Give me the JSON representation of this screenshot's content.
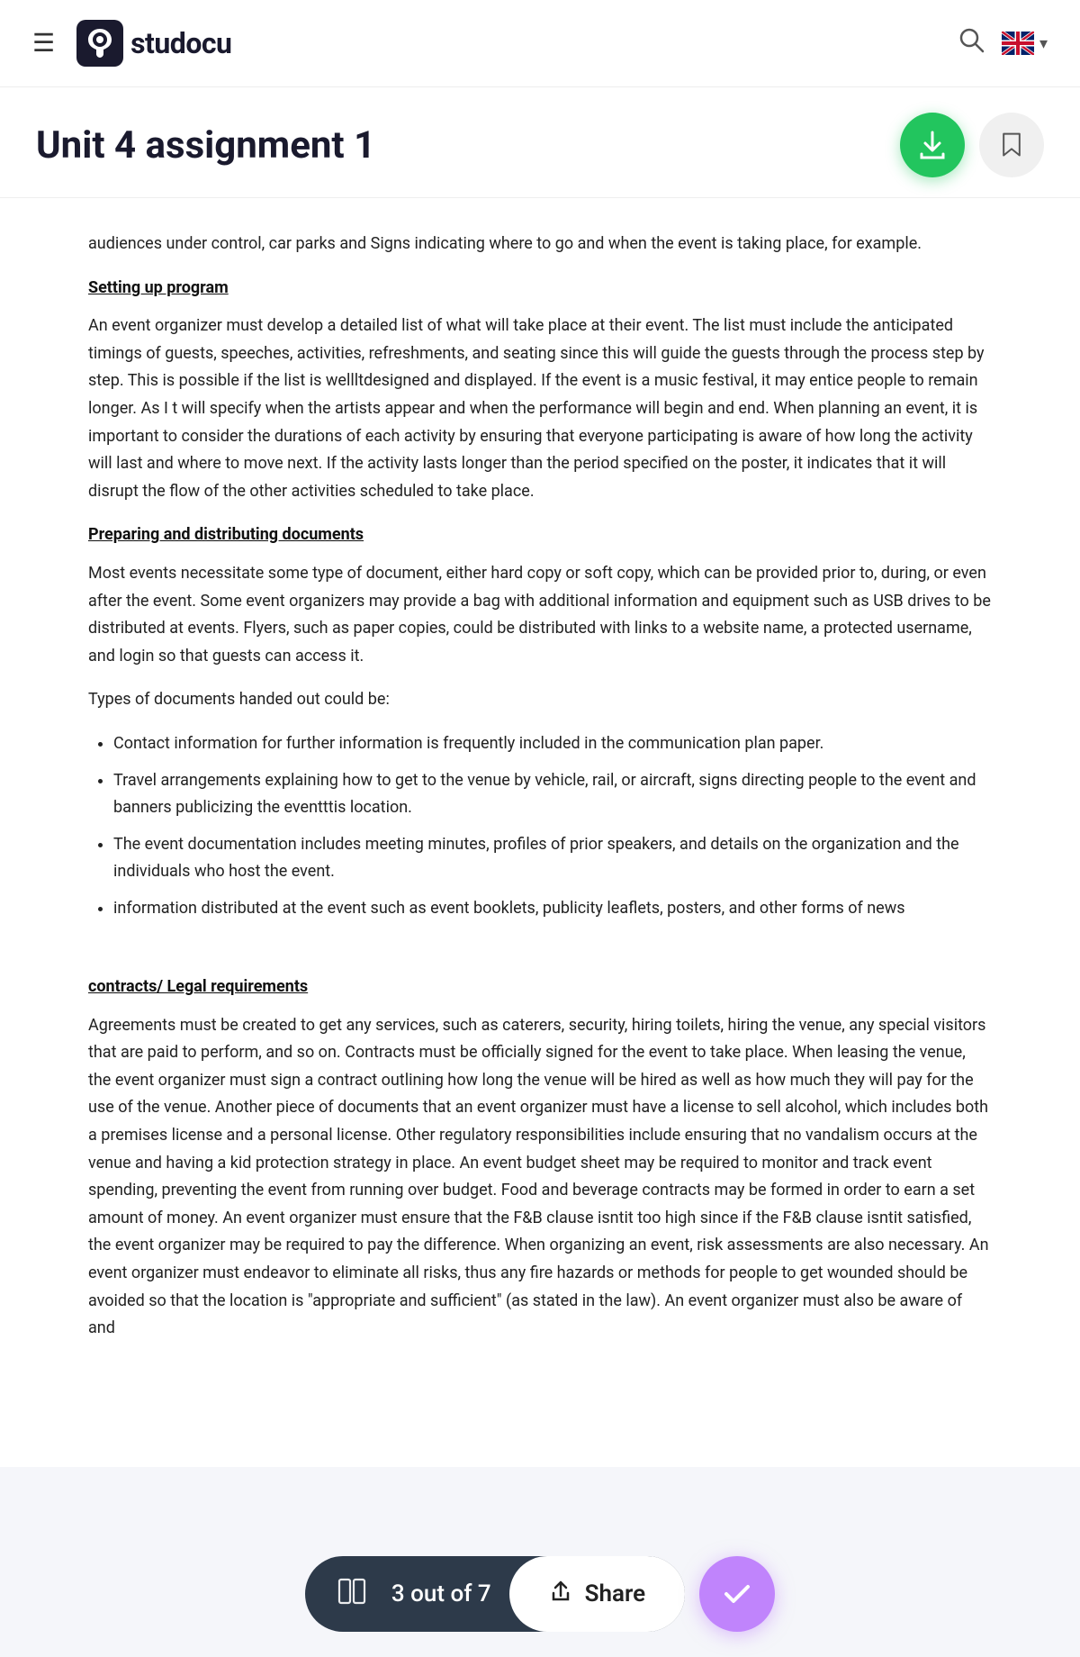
{
  "header": {
    "hamburger_label": "☰",
    "logo_text": "studocu",
    "search_aria": "Search",
    "lang": "EN",
    "chevron": "▾"
  },
  "document": {
    "title": "Unit 4 assignment 1",
    "download_aria": "Download",
    "bookmark_aria": "Bookmark"
  },
  "content": {
    "intro_text": "audiences under control, car parks and Signs indicating where to go and when the event is taking place, for example.",
    "section1_heading": "Setting up program",
    "section1_body": "An event organizer must develop a detailed list of what will take place at their event. The list must include the anticipated timings of guests, speeches, activities, refreshments, and seating since this will guide the guests through the process step by step.  This is possible if the list is wellltdesigned and displayed. If the event is a music festival, it may entice people to remain longer. As I t will specify when the artists appear and when the performance will begin and end. When planning an event, it is important to consider the durations of each activity by ensuring that everyone participating is aware of how long the activity will last and where to move next. If the  activity lasts longer than the period specified on the poster, it indicates that it will disrupt the flow of the other activities scheduled to take place.",
    "section2_heading": "Preparing and distributing documents",
    "section2_body": "Most events necessitate some type of document, either hard copy or soft copy, which can be provided prior to, during, or even after the event. Some event organizers may provide a bag with additional information and equipment such as USB drives to be distributed at events. Flyers, such as paper copies, could be distributed with links to a website name, a protected username, and login so that guests can access it.",
    "types_intro": "Types of documents handed out could be:",
    "bullet_items": [
      "Contact information for further information is frequently included in the communication plan paper.",
      "Travel arrangements explaining how to get to the venue by vehicle, rail, or aircraft, signs directing people to the event and banners publicizing the eventttis location.",
      "The event documentation includes meeting minutes, profiles of prior speakers, and details on the organization and the individuals who host the event.",
      "information distributed at the event such as event booklets, publicity leaflets, posters, and other forms of news"
    ],
    "section3_heading": "contracts/ Legal requirements",
    "section3_body": "Agreements must be created to get any services, such as caterers, security, hiring toilets, hiring the venue, any special visitors that are paid to perform, and so on. Contracts must be officially signed for the event to take place. When leasing the venue, the event organizer must sign a contract outlining how long the venue will be hired as well as how much they will pay for the use of the venue. Another piece of documents that an event organizer must have a license to sell alcohol, which includes both a premises license and a personal license. Other regulatory responsibilities include ensuring that no vandalism occurs at the venue and having a kid protection strategy in place. An event budget sheet may be required to monitor and track event spending, preventing the event from running over budget. Food and beverage contracts may be formed in order to earn a set amount of money. An event organizer must ensure that the F&B clause isntit too high since if the F&B clause isntit satisfied, the event organizer may be required to pay the difference. When organizing an event, risk assessments are also necessary. An event organizer must endeavor to eliminate all risks, thus any fire hazards or methods for people to get wounded should be avoided so that the location is \"appropriate and sufficient\" (as stated in the law). An event organizer must also be aware of and"
  },
  "bottom_bar": {
    "page_count": "3 out of 7",
    "share_label": "Share",
    "verified_aria": "Verified"
  }
}
